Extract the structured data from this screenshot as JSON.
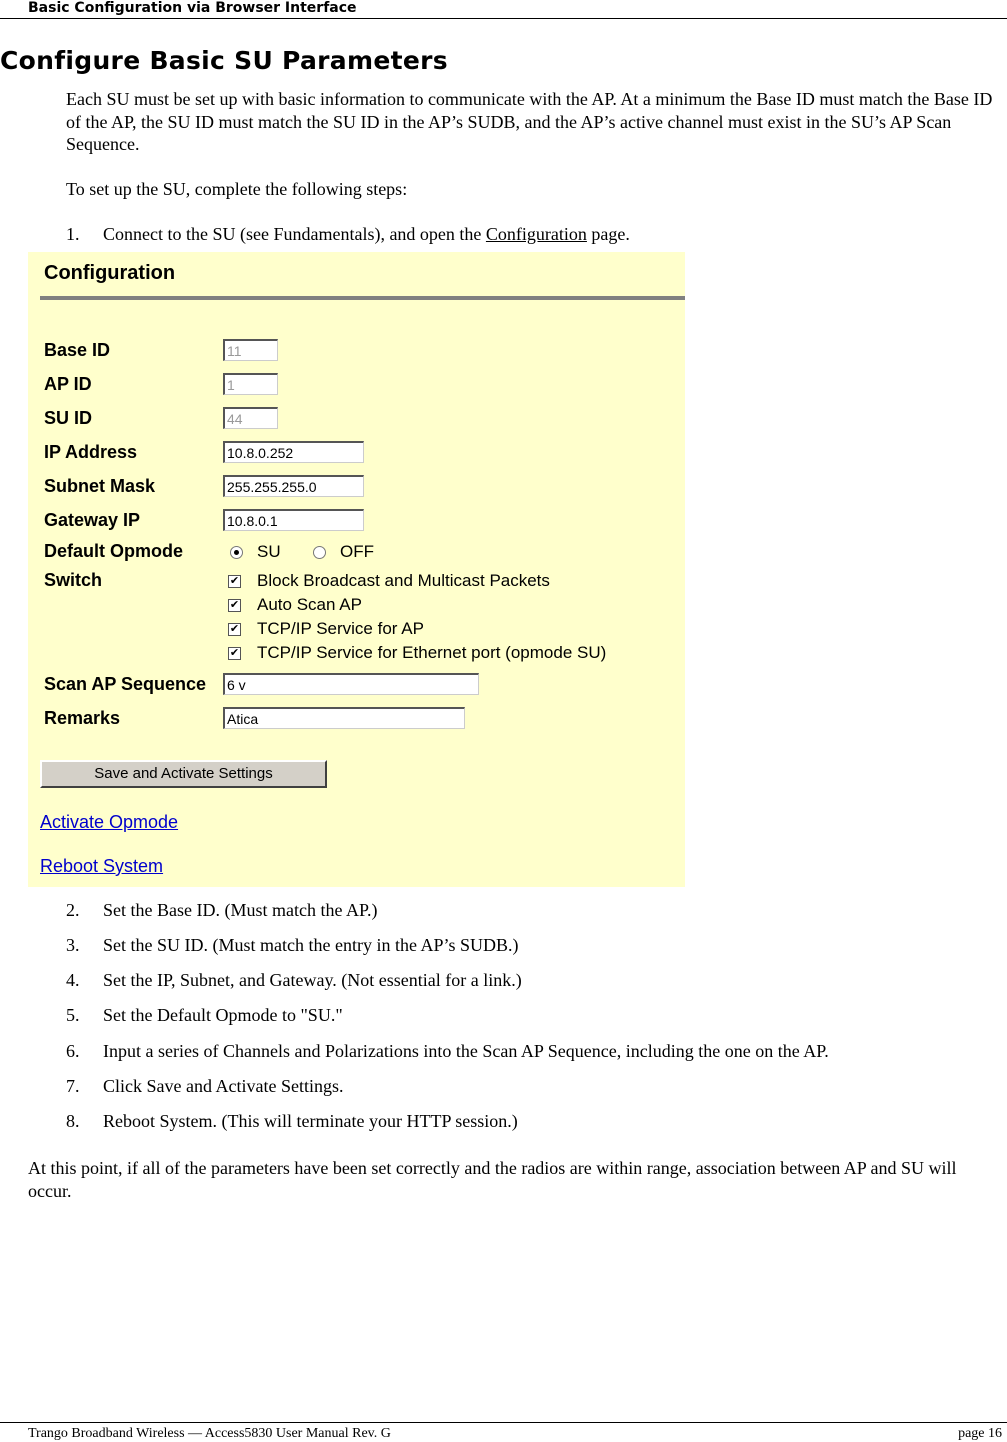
{
  "header": {
    "title": "Basic Configuration via Browser Interface"
  },
  "heading": "Configure Basic SU Parameters",
  "intro": "Each SU must be set up with basic information to communicate with the AP.  At a minimum the Base ID must match the Base ID of the AP, the SU ID must match the SU ID in the AP’s SUDB, and the AP’s active channel must exist in the SU’s AP Scan Sequence.",
  "steps_intro": "To set up the SU, complete the following steps:",
  "step1": {
    "num": "1.",
    "before": "Connect to the SU (see Fundamentals), and open the ",
    "link": "Configuration",
    "after": " page."
  },
  "config": {
    "title": "Configuration",
    "fields": {
      "base_id": {
        "label": "Base ID",
        "value": "11"
      },
      "ap_id": {
        "label": "AP ID",
        "value": "1"
      },
      "su_id": {
        "label": "SU ID",
        "value": "44"
      },
      "ip": {
        "label": "IP Address",
        "value": "10.8.0.252"
      },
      "subnet": {
        "label": "Subnet Mask",
        "value": "255.255.255.0"
      },
      "gateway": {
        "label": "Gateway IP",
        "value": "10.8.0.1"
      },
      "scan": {
        "label": "Scan AP Sequence",
        "value": "6 v"
      },
      "remarks": {
        "label": "Remarks",
        "value": "Atica"
      }
    },
    "opmode": {
      "label": "Default Opmode",
      "options": [
        "SU",
        "OFF"
      ],
      "selected": "SU"
    },
    "switch": {
      "label": "Switch",
      "items": [
        {
          "label": "Block Broadcast and Multicast Packets",
          "checked": true
        },
        {
          "label": "Auto Scan AP",
          "checked": true
        },
        {
          "label": "TCP/IP Service for AP",
          "checked": true
        },
        {
          "label": "TCP/IP Service for Ethernet port (opmode SU)",
          "checked": true
        }
      ]
    },
    "save_button": "Save and Activate Settings",
    "links": {
      "activate": "Activate Opmode",
      "reboot": "Reboot System"
    },
    "colors": {
      "background": "#ffffcc",
      "link": "#0000cc"
    }
  },
  "steps": [
    {
      "num": "2.",
      "text": "Set the Base ID.  (Must match the AP.)"
    },
    {
      "num": "3.",
      "text": "Set the SU ID.  (Must match the entry in the AP’s SUDB.)"
    },
    {
      "num": "4.",
      "text": "Set the IP, Subnet, and Gateway. (Not essential for a link.)"
    },
    {
      "num": "5.",
      "text": "Set the Default Opmode to \"SU.\""
    },
    {
      "num": "6.",
      "text": "Input a series of Channels and Polarizations into the Scan AP Sequence, including the one on the AP."
    },
    {
      "num": "7.",
      "text": "Click Save and Activate Settings."
    },
    {
      "num": "8.",
      "text": "Reboot System. (This will terminate your HTTP session.)"
    }
  ],
  "closing": "At this point, if all of the parameters have been set correctly and the radios are within range, association between AP and SU will occur.",
  "footer": {
    "left": "Trango Broadband Wireless — Access5830 User Manual  Rev. G",
    "right": "page 16"
  }
}
